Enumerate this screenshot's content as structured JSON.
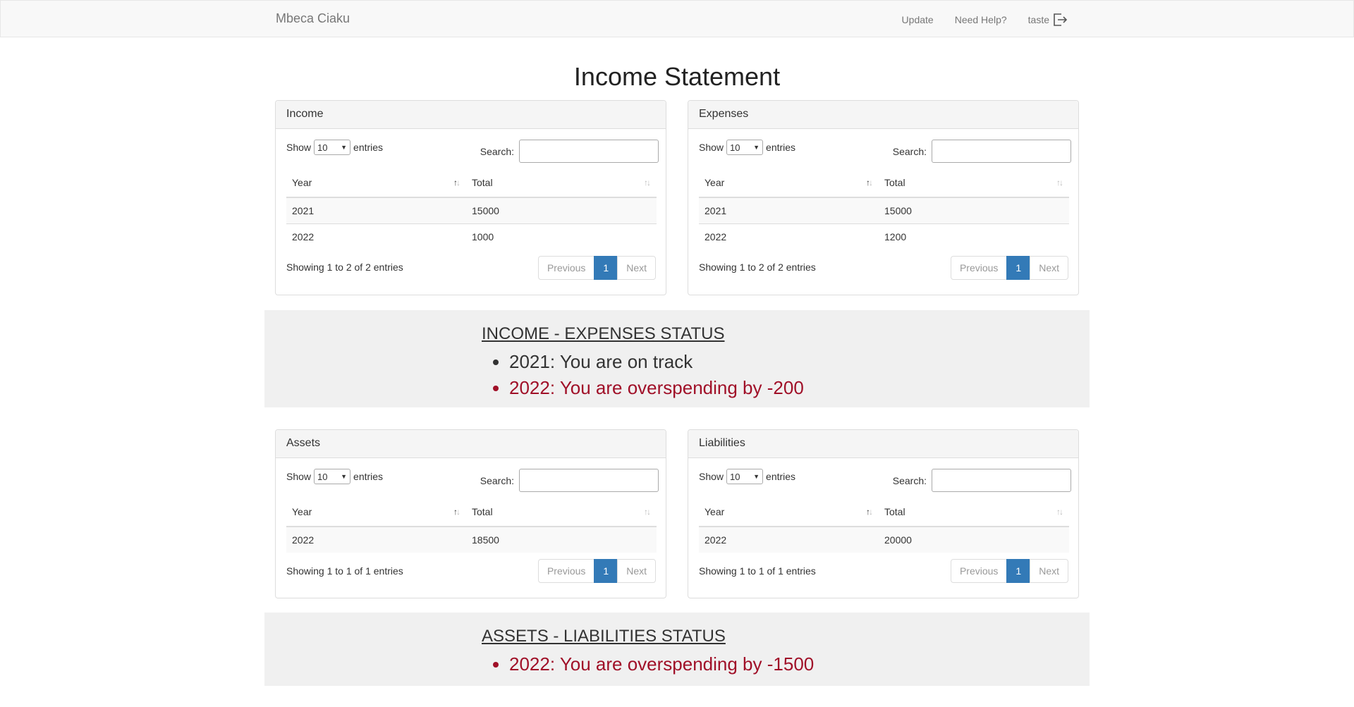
{
  "navbar": {
    "brand": "Mbeca Ciaku",
    "links": [
      "Update",
      "Need Help?",
      "taste"
    ]
  },
  "page_title": "Income Statement",
  "common": {
    "show_label": "Show",
    "entries_label": "entries",
    "page_size": "10",
    "search_label": "Search:",
    "col_year": "Year",
    "col_total": "Total",
    "prev_label": "Previous",
    "page_num": "1",
    "next_label": "Next"
  },
  "income": {
    "title": "Income",
    "rows": [
      {
        "year": "2021",
        "total": "15000"
      },
      {
        "year": "2022",
        "total": "1000"
      }
    ],
    "info": "Showing 1 to 2 of 2 entries"
  },
  "expenses": {
    "title": "Expenses",
    "rows": [
      {
        "year": "2021",
        "total": "15000"
      },
      {
        "year": "2022",
        "total": "1200"
      }
    ],
    "info": "Showing 1 to 2 of 2 entries"
  },
  "ie_status": {
    "title": "INCOME - EXPENSES STATUS",
    "items": [
      {
        "text": "2021: You are on track",
        "state": "ok"
      },
      {
        "text": "2022: You are overspending by -200",
        "state": "bad"
      }
    ]
  },
  "assets": {
    "title": "Assets",
    "rows": [
      {
        "year": "2022",
        "total": "18500"
      }
    ],
    "info": "Showing 1 to 1 of 1 entries"
  },
  "liabilities": {
    "title": "Liabilities",
    "rows": [
      {
        "year": "2022",
        "total": "20000"
      }
    ],
    "info": "Showing 1 to 1 of 1 entries"
  },
  "al_status": {
    "title": "ASSETS - LIABILITIES STATUS",
    "items": [
      {
        "text": "2022: You are overspending by -1500",
        "state": "bad"
      }
    ]
  },
  "colors": {
    "accent": "#337ab7",
    "danger": "#a01028",
    "status_bg": "#f0f0f0"
  }
}
